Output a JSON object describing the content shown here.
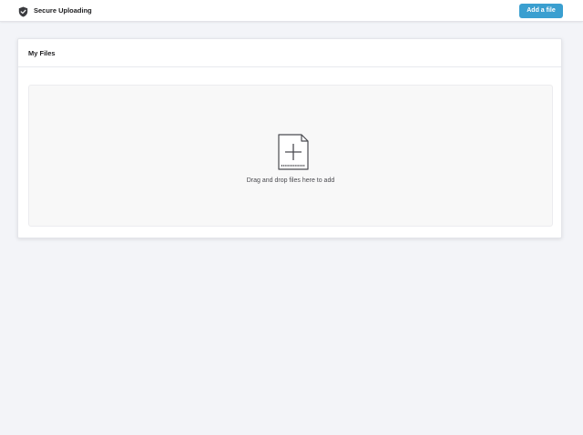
{
  "header": {
    "brand_icon": "shield-check-icon",
    "title": "Secure Uploading",
    "add_button_label": "Add a file"
  },
  "card": {
    "title": "My Files",
    "dropzone": {
      "icon": "file-add-icon",
      "text": "Drag and drop files here to add"
    }
  },
  "colors": {
    "accent": "#3a9fd0",
    "background": "#f3f4f8",
    "card": "#ffffff",
    "dropzone": "#f8f8f8"
  }
}
